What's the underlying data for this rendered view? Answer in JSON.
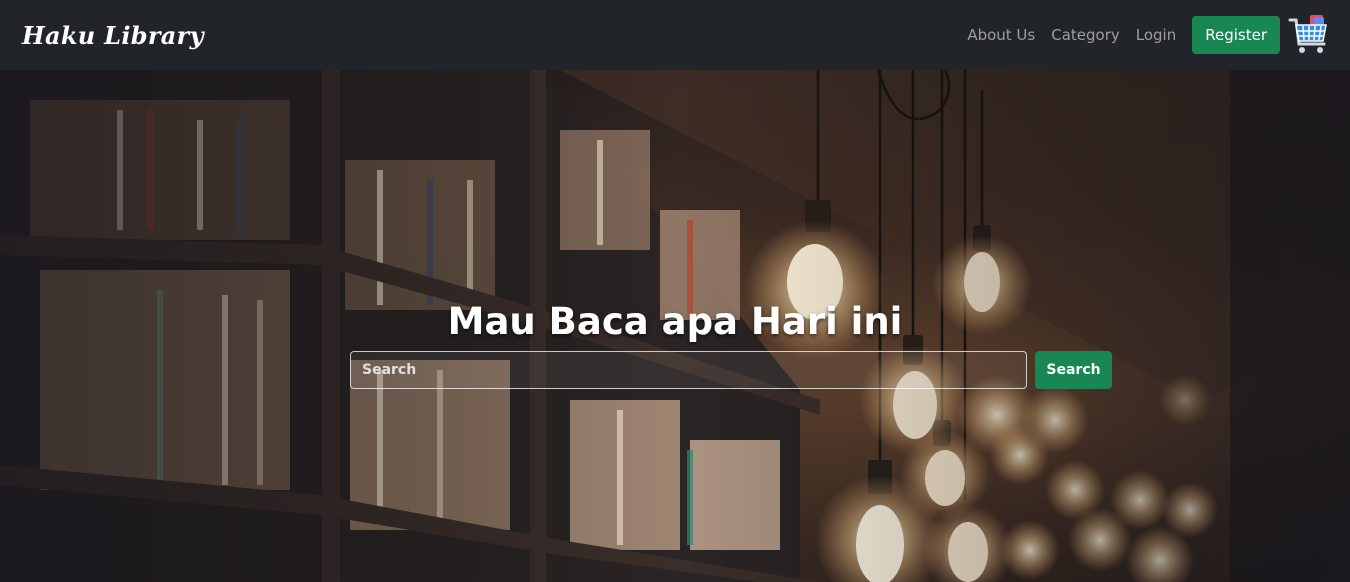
{
  "navbar": {
    "brand": "Haku Library",
    "links": [
      "About Us",
      "Category",
      "Login"
    ],
    "register_label": "Register",
    "cart_icon": "shopping-cart-icon"
  },
  "hero": {
    "title": "Mau Baca apa Hari ini",
    "search": {
      "placeholder": "Search",
      "value": ""
    },
    "search_button_label": "Search",
    "background_image": "library-bookshelves-hanging-bulbs"
  },
  "colors": {
    "navbar_bg": "#212529",
    "accent_green": "#198754",
    "nav_link": "rgba(255,255,255,0.55)"
  }
}
